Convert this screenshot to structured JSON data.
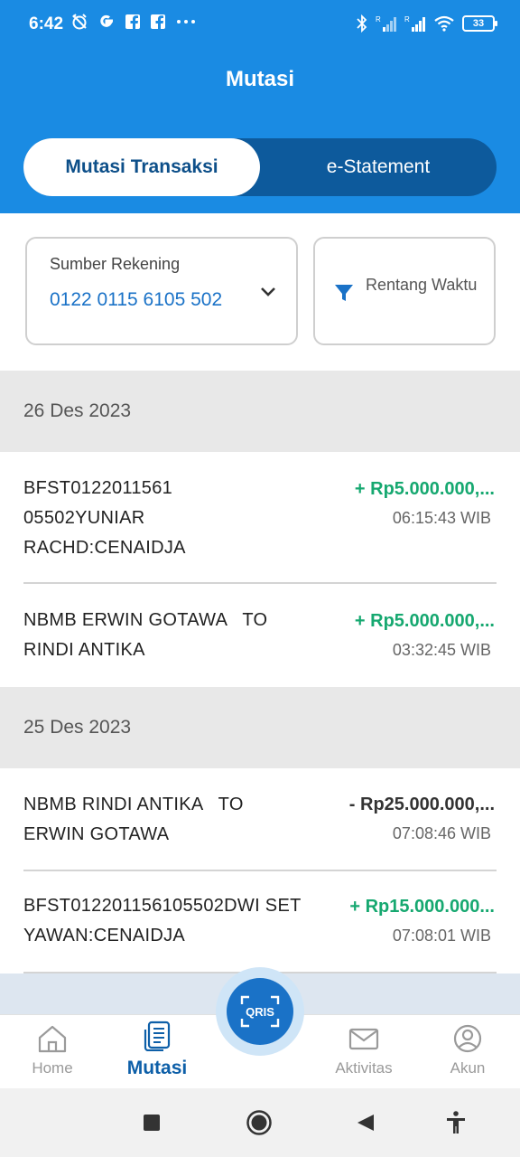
{
  "status_bar": {
    "time": "6:42",
    "left_icons": [
      "alarm-off-icon",
      "google-icon",
      "facebook-icon",
      "facebook-icon",
      "more-icon"
    ],
    "right_icons": [
      "bluetooth-icon",
      "signal-r-icon",
      "signal-r-icon",
      "wifi-icon",
      "battery-icon"
    ],
    "battery": "33"
  },
  "header": {
    "title": "Mutasi",
    "tabs": [
      {
        "label": "Mutasi Transaksi",
        "active": true
      },
      {
        "label": "e-Statement",
        "active": false
      }
    ]
  },
  "filters": {
    "source_label": "Sumber Rekening",
    "source_account": "0122 0115 6105 502",
    "time_range_label": "Rentang Waktu"
  },
  "sections": [
    {
      "date": "26 Des 2023",
      "transactions": [
        {
          "description": "BFST0122011561 05502YUNIAR RACHD:CENAIDJA",
          "amount": "+ Rp5.000.000,...",
          "time": "06:15:43 WIB",
          "type": "credit"
        },
        {
          "description": "NBMB ERWIN GOTAWA   TO RINDI ANTIKA",
          "amount": "+ Rp5.000.000,...",
          "time": "03:32:45 WIB",
          "type": "credit"
        }
      ]
    },
    {
      "date": "25 Des 2023",
      "transactions": [
        {
          "description": "NBMB RINDI ANTIKA   TO ERWIN GOTAWA",
          "amount": "- Rp25.000.000,...",
          "time": "07:08:46 WIB",
          "type": "debit"
        },
        {
          "description": "BFST012201156105502DWI SETYAWAN:CENAIDJA",
          "amount": "+ Rp15.000.000...",
          "time": "07:08:01 WIB",
          "type": "credit"
        }
      ]
    }
  ],
  "bottom_nav": {
    "items": [
      {
        "label": "Home",
        "icon": "home-icon",
        "active": false
      },
      {
        "label": "Mutasi",
        "icon": "document-icon",
        "active": true
      },
      {
        "label": "Aktivitas",
        "icon": "envelope-icon",
        "active": false
      },
      {
        "label": "Akun",
        "icon": "user-icon",
        "active": false
      }
    ],
    "center_button": "QRIS"
  },
  "system_nav": [
    "recents-icon",
    "home-circle-icon",
    "back-icon",
    "accessibility-icon"
  ],
  "colors": {
    "primary": "#1a8be3",
    "dark_primary": "#0d5a9c",
    "credit": "#16a870",
    "debit": "#333333"
  }
}
